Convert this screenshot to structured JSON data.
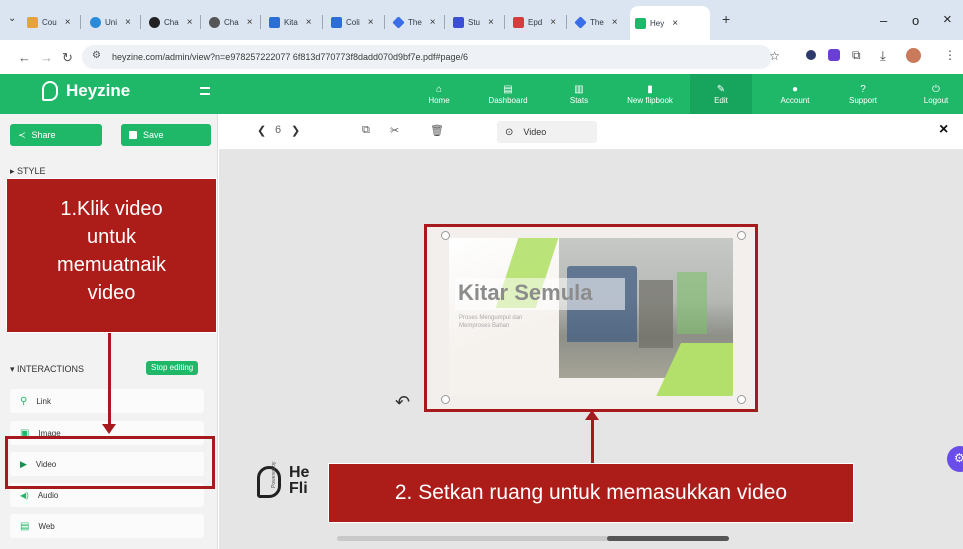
{
  "browser": {
    "tabs": [
      {
        "label": "Cou",
        "favicon_color": "#e7a33b"
      },
      {
        "label": "Uni",
        "favicon_color": "#2a8cd8"
      },
      {
        "label": "Cha",
        "favicon_color": "#222222"
      },
      {
        "label": "Cha",
        "favicon_color": "#555555"
      },
      {
        "label": "Kita",
        "favicon_color": "#2b6fd6"
      },
      {
        "label": "Coli",
        "favicon_color": "#2b6fd6"
      },
      {
        "label": "The",
        "favicon_color": "#3a6ee8"
      },
      {
        "label": "Stu",
        "favicon_color": "#3a4fd6"
      },
      {
        "label": "Epd",
        "favicon_color": "#d43d3d"
      },
      {
        "label": "The",
        "favicon_color": "#3a6ee8"
      },
      {
        "label": "Hey",
        "favicon_color": "#1fb869"
      }
    ],
    "url": "heyzine.com/admin/view?n=e978257222077 6f813d770773f8dadd070d9bf7e.pdf#page/6",
    "new_tab": "+",
    "minimize": "–",
    "restore": "o",
    "close": "×"
  },
  "app": {
    "brand": "Heyzine",
    "menu": [
      {
        "label": "Home",
        "icon": "home-icon",
        "glyph": "⌂"
      },
      {
        "label": "Dashboard",
        "icon": "dashboard-icon",
        "glyph": "▤"
      },
      {
        "label": "Stats",
        "icon": "stats-icon",
        "glyph": "▥"
      },
      {
        "label": "New flipbook",
        "icon": "new-file-icon",
        "glyph": "▮"
      },
      {
        "label": "Edit",
        "icon": "pencil-icon",
        "glyph": "✎"
      },
      {
        "label": "Account",
        "icon": "account-icon",
        "glyph": "●"
      },
      {
        "label": "Support",
        "icon": "help-icon",
        "glyph": "?"
      },
      {
        "label": "Logout",
        "icon": "power-icon",
        "glyph": "⏻"
      }
    ],
    "accent": "#1fb869"
  },
  "sidebar": {
    "share_label": "Share",
    "save_label": "Save",
    "style_label": "▸ STYLE",
    "interactions_label": "▾ INTERACTIONS",
    "stop_editing_label": "Stop editing",
    "items": [
      {
        "label": "Link",
        "icon": "link-icon",
        "glyph": "⚲"
      },
      {
        "label": "Image",
        "icon": "image-icon",
        "glyph": "▣"
      },
      {
        "label": "Video",
        "icon": "play-icon",
        "glyph": "▶"
      },
      {
        "label": "Audio",
        "icon": "audio-icon",
        "glyph": "◀)"
      },
      {
        "label": "Web",
        "icon": "web-icon",
        "glyph": "▤"
      }
    ]
  },
  "toolbar": {
    "page_number": "6",
    "video_label": "Video",
    "close": "×"
  },
  "slide": {
    "title": "Kitar Semula",
    "subtitle": "Proses Mengumpul dan Memproses Bahan"
  },
  "logo_text": {
    "line1": "He",
    "line2": "Fli",
    "vertical": "Powered by"
  },
  "annotations": {
    "step1_lines": [
      "1.Klik video",
      "untuk",
      "memuatnaik",
      "video"
    ],
    "step2": "2. Setkan ruang untuk memasukkan video",
    "color": "#ac1d1a"
  }
}
